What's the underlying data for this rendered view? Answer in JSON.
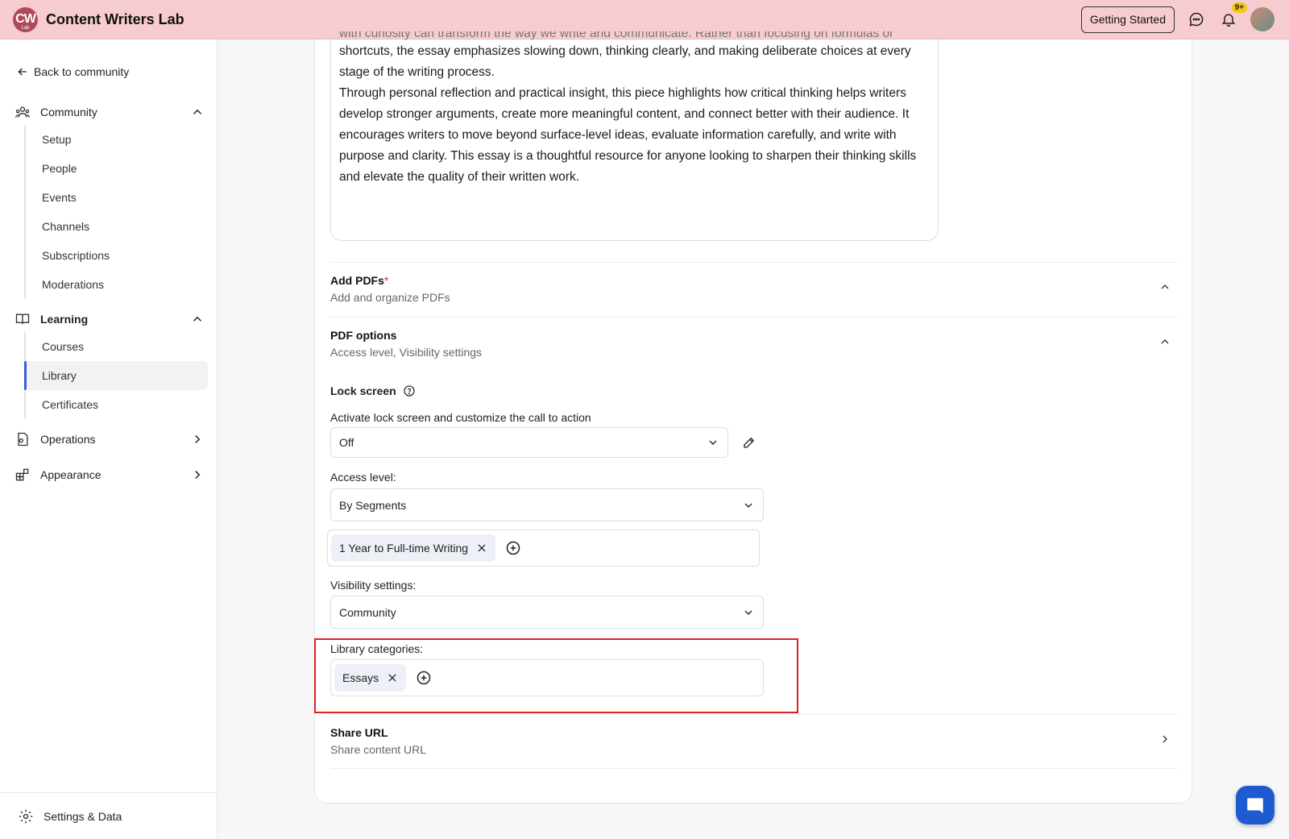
{
  "header": {
    "logo_text": "CW",
    "logo_sub": "Lab",
    "brand": "Content Writers Lab",
    "getting_started": "Getting Started",
    "notification_count": "9+"
  },
  "sidebar": {
    "back_label": "Back to community",
    "community_label": "Community",
    "community_items": [
      "Setup",
      "People",
      "Events",
      "Channels",
      "Subscriptions",
      "Moderations"
    ],
    "learning_label": "Learning",
    "learning_items": [
      "Courses",
      "Library",
      "Certificates"
    ],
    "active_item": "Library",
    "operations_label": "Operations",
    "appearance_label": "Appearance",
    "settings_label": "Settings & Data"
  },
  "description": {
    "cut_line": "with curiosity can transform the way we write and communicate. Rather than focusing on formulas or",
    "para1": "shortcuts, the essay emphasizes slowing down, thinking clearly, and making deliberate choices at every stage of the writing process.",
    "para2": "Through personal reflection and practical insight, this piece highlights how critical thinking helps writers develop stronger arguments, create more meaningful content, and connect better with their audience. It encourages writers to move beyond surface-level ideas, evaluate information carefully, and write with purpose and clarity. This essay is a thoughtful resource for anyone looking to sharpen their thinking skills and elevate the quality of their written work."
  },
  "add_pdfs": {
    "title": "Add PDFs",
    "required_mark": "*",
    "subtitle": "Add and organize PDFs"
  },
  "pdf_options": {
    "title": "PDF options",
    "subtitle": "Access level, Visibility settings"
  },
  "lock_screen": {
    "title": "Lock screen",
    "help": "Activate lock screen and customize the call to action",
    "value": "Off"
  },
  "access_level": {
    "label": "Access level:",
    "value": "By Segments",
    "segments": [
      "1 Year to Full-time Writing"
    ]
  },
  "visibility": {
    "label": "Visibility settings:",
    "value": "Community"
  },
  "library_categories": {
    "label": "Library categories:",
    "tags": [
      "Essays"
    ]
  },
  "share_url": {
    "title": "Share URL",
    "subtitle": "Share content URL"
  },
  "colors": {
    "topbar": "#f6ccd0",
    "accent": "#3b5bdb",
    "highlight": "#e02020",
    "chat": "#1f5bd0"
  }
}
